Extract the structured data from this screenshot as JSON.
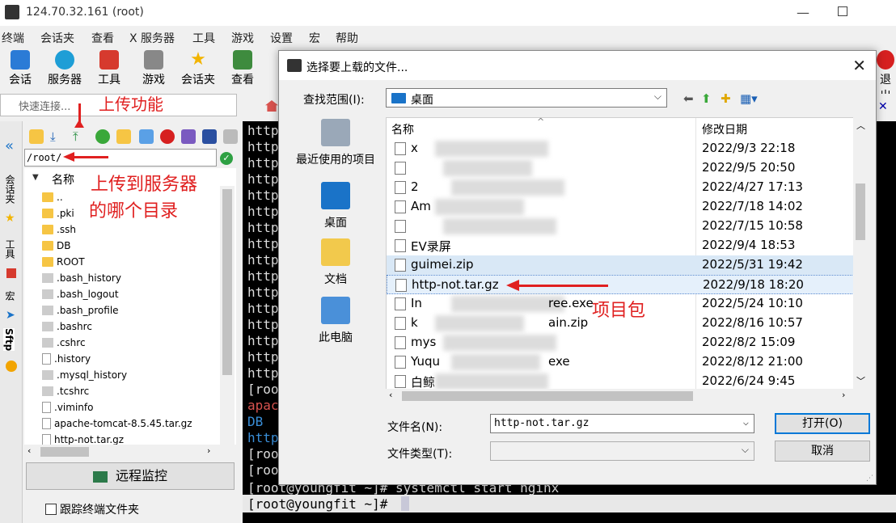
{
  "window": {
    "title": "124.70.32.161 (root)"
  },
  "menu": [
    "终端",
    "会话夹",
    "查看",
    "X 服务器",
    "工具",
    "游戏",
    "设置",
    "宏",
    "帮助"
  ],
  "toolbar": [
    {
      "label": "会话",
      "icon": "session-icon"
    },
    {
      "label": "服务器",
      "icon": "servers-icon"
    },
    {
      "label": "工具",
      "icon": "tools-icon"
    },
    {
      "label": "游戏",
      "icon": "games-icon"
    },
    {
      "label": "会话夹",
      "icon": "star-icon"
    },
    {
      "label": "查看",
      "icon": "view-icon"
    }
  ],
  "toolbar_exit": "退出",
  "quick_connect": "快速连接...",
  "side_tabs": [
    "会话夹",
    "工具",
    "宏",
    "Sftp"
  ],
  "sftp": {
    "path": "/root/",
    "column": "名称",
    "files": [
      {
        "name": "..",
        "kind": "up"
      },
      {
        "name": ".pki",
        "kind": "folder"
      },
      {
        "name": ".ssh",
        "kind": "folder"
      },
      {
        "name": "DB",
        "kind": "folder"
      },
      {
        "name": "ROOT",
        "kind": "folder"
      },
      {
        "name": ".bash_history",
        "kind": "dot"
      },
      {
        "name": ".bash_logout",
        "kind": "dot"
      },
      {
        "name": ".bash_profile",
        "kind": "dot"
      },
      {
        "name": ".bashrc",
        "kind": "dot"
      },
      {
        "name": ".cshrc",
        "kind": "dot"
      },
      {
        "name": ".history",
        "kind": "file"
      },
      {
        "name": ".mysql_history",
        "kind": "dot"
      },
      {
        "name": ".tcshrc",
        "kind": "dot"
      },
      {
        "name": ".viminfo",
        "kind": "file"
      },
      {
        "name": "apache-tomcat-8.5.45.tar.gz",
        "kind": "file"
      },
      {
        "name": "http-not.tar.gz",
        "kind": "file"
      }
    ],
    "remote_monitor": "远程监控",
    "follow_folder": "跟踪终端文件夹"
  },
  "annotations": {
    "upload": "上传功能",
    "target_line1": "上传到服务器",
    "target_line2": "的哪个目录",
    "package": "项目包"
  },
  "terminal": {
    "lines": [
      "http",
      "http",
      "http",
      "http",
      "http",
      "http",
      "http",
      "http",
      "http",
      "http",
      "http",
      "http",
      "http",
      "http",
      "http",
      "http",
      "[root",
      "apac",
      "DB",
      "http",
      "[roo",
      "[roo"
    ],
    "cmd1": "[root@youngfit ~]# systemctl start nginx",
    "cmd2": "[root@youngfit ~]# "
  },
  "dialog": {
    "title": "选择要上载的文件...",
    "look_in_label": "查找范围(I):",
    "look_in_value": "桌面",
    "places": [
      "最近使用的项目",
      "桌面",
      "文档",
      "此电脑"
    ],
    "col_name": "名称",
    "col_date": "修改日期",
    "files": [
      {
        "name": "x",
        "date": "2022/9/3 22:18",
        "blurred": true
      },
      {
        "name": "",
        "date": "2022/9/5 20:50",
        "blurred": true
      },
      {
        "name": "2",
        "date": "2022/4/27 17:13",
        "blurred": true
      },
      {
        "name": "Am",
        "date": "2022/7/18 14:02",
        "blurred": true
      },
      {
        "name": "",
        "date": "2022/7/15 10:58",
        "blurred": true
      },
      {
        "name": "EV录屏",
        "date": "2022/9/4 18:53",
        "blurred": false
      },
      {
        "name": "guimei.zip",
        "date": "2022/5/31 19:42",
        "blurred": false
      },
      {
        "name": "http-not.tar.gz",
        "date": "2022/9/18 18:20",
        "blurred": false
      },
      {
        "name": "In",
        "date": "2022/5/24 10:10",
        "blurred": true,
        "suffix": "ree.exe"
      },
      {
        "name": "k",
        "date": "2022/8/16 10:57",
        "blurred": true,
        "suffix": "ain.zip"
      },
      {
        "name": "mys",
        "date": "2022/8/2 15:09",
        "blurred": true
      },
      {
        "name": "Yuqu",
        "date": "2022/8/12 21:00",
        "blurred": true,
        "suffix": "exe"
      },
      {
        "name": "白鲸",
        "date": "2022/6/24 9:45",
        "blurred": true
      }
    ],
    "filename_label": "文件名(N):",
    "filename_value": "http-not.tar.gz",
    "filetype_label": "文件类型(T):",
    "filetype_value": "",
    "open_button": "打开(O)",
    "cancel_button": "取消"
  }
}
